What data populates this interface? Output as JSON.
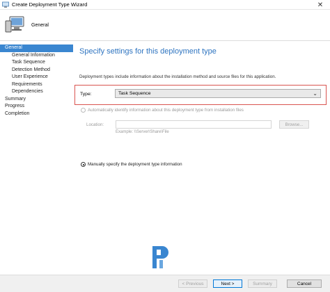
{
  "window": {
    "title": "Create Deployment Type Wizard",
    "close_glyph": "✕"
  },
  "header": {
    "heading": "General"
  },
  "sidebar": {
    "items": [
      {
        "label": "General",
        "active": true
      },
      {
        "label": "General Information"
      },
      {
        "label": "Task Sequence"
      },
      {
        "label": "Detection Method"
      },
      {
        "label": "User Experience"
      },
      {
        "label": "Requirements"
      },
      {
        "label": "Dependencies"
      },
      {
        "label": "Summary"
      },
      {
        "label": "Progress"
      },
      {
        "label": "Completion"
      }
    ]
  },
  "main": {
    "heading": "Specify settings for this deployment type",
    "description": "Deployment types include information about the installation method and source files for this application.",
    "type_label": "Type:",
    "type_value": "Task Sequence",
    "auto_option": "Automatically identify information about this deployment type from installation files",
    "location_label": "Location:",
    "location_value": "",
    "browse_label": "Browse...",
    "example_text": "Example: \\\\Server\\Share\\File",
    "manual_option": "Manually specify the deployment type information",
    "selected_option": "manual"
  },
  "footer": {
    "previous": "< Previous",
    "next": "Next >",
    "summary": "Summary",
    "cancel": "Cancel"
  },
  "colors": {
    "accent": "#3a86d0",
    "heading": "#2e74c0",
    "highlight_border": "#d9534f",
    "watermark": "#3a86d0"
  },
  "icons": {
    "app": "computer-icon",
    "header": "computer-monitor-icon",
    "dropdown": "chevron-down-icon",
    "watermark": "logo-watermark"
  }
}
